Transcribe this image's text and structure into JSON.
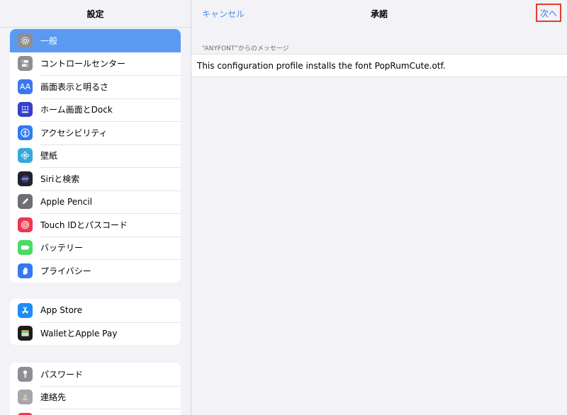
{
  "sidebar": {
    "title": "設定",
    "groups": [
      {
        "items": [
          {
            "label": "一般",
            "icon": "gear-icon",
            "color": "#8e8e93",
            "selected": true
          },
          {
            "label": "コントロールセンター",
            "icon": "toggle-icon",
            "color": "#8e8e93"
          },
          {
            "label": "画面表示と明るさ",
            "icon": "text-size-icon",
            "color": "#3a76f0",
            "glyph": "AA"
          },
          {
            "label": "ホーム画面とDock",
            "icon": "home-grid-icon",
            "color": "#3440c9"
          },
          {
            "label": "アクセシビリティ",
            "icon": "accessibility-icon",
            "color": "#2f7bf5"
          },
          {
            "label": "壁紙",
            "icon": "flower-icon",
            "color": "#34aadc"
          },
          {
            "label": "Siriと検索",
            "icon": "siri-icon",
            "color": "#222230"
          },
          {
            "label": "Apple Pencil",
            "icon": "pencil-icon",
            "color": "#6e6e73"
          },
          {
            "label": "Touch IDとパスコード",
            "icon": "fingerprint-icon",
            "color": "#f0364f"
          },
          {
            "label": "バッテリー",
            "icon": "battery-icon",
            "color": "#4cd964"
          },
          {
            "label": "プライバシー",
            "icon": "hand-icon",
            "color": "#3478f6"
          }
        ]
      },
      {
        "items": [
          {
            "label": "App Store",
            "icon": "app-store-icon",
            "color": "#1d8cf8"
          },
          {
            "label": "WalletとApple Pay",
            "icon": "wallet-icon",
            "color": "#1c1c1e"
          }
        ]
      },
      {
        "items": [
          {
            "label": "パスワード",
            "icon": "key-icon",
            "color": "#8e8e93"
          },
          {
            "label": "連絡先",
            "icon": "contacts-icon",
            "color": "#a7a7ab"
          },
          {
            "label": "",
            "icon": "calendar-icon",
            "color": "#f0364f"
          }
        ]
      }
    ]
  },
  "detail": {
    "cancel_label": "キャンセル",
    "title": "承諾",
    "next_label": "次へ",
    "caption": "“ANYFONT”からのメッセージ",
    "message": "This configuration profile installs the font PopRumCute.otf."
  }
}
